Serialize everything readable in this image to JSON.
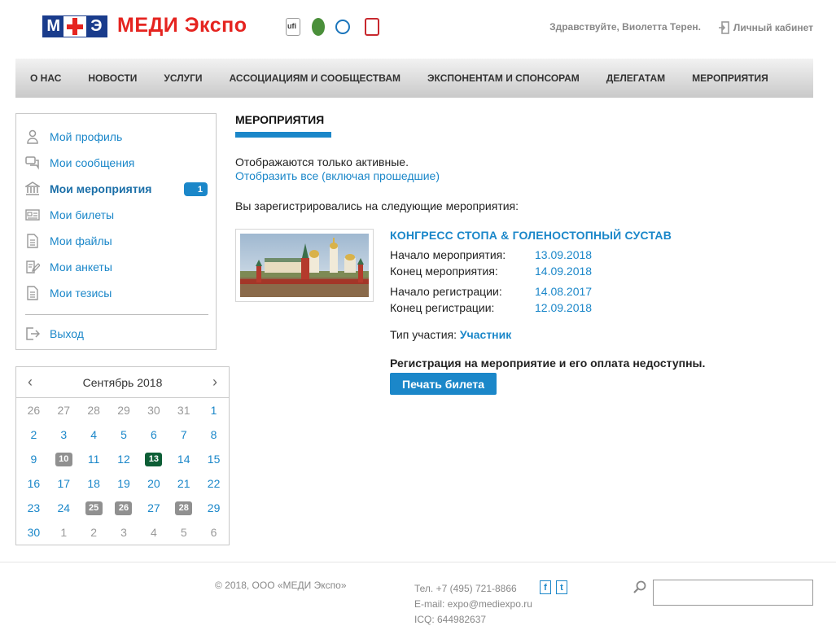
{
  "header": {
    "logo_m": "М",
    "logo_e": "Э",
    "brand": "МЕДИ Экспо",
    "greeting": "Здравствуйте, Виолетта Терен.",
    "cabinet": "Личный кабинет"
  },
  "nav": [
    "О НАС",
    "НОВОСТИ",
    "УСЛУГИ",
    "АССОЦИАЦИЯМ И СООБЩЕСТВАМ",
    "ЭКСПОНЕНТАМ И СПОНСОРАМ",
    "ДЕЛЕГАТАМ",
    "МЕРОПРИЯТИЯ"
  ],
  "sidebar": {
    "items": [
      {
        "label": "Мой профиль",
        "icon": "user-icon"
      },
      {
        "label": "Мои сообщения",
        "icon": "messages-icon"
      },
      {
        "label": "Мои мероприятия",
        "icon": "museum-icon",
        "badge": "1",
        "active": true
      },
      {
        "label": "Мои билеты",
        "icon": "ticket-icon"
      },
      {
        "label": "Мои файлы",
        "icon": "file-icon"
      },
      {
        "label": "Мои анкеты",
        "icon": "edit-form-icon"
      },
      {
        "label": "Мои тезисы",
        "icon": "document-icon"
      }
    ],
    "logout": "Выход"
  },
  "calendar": {
    "month": "Сентябрь 2018",
    "prev": "‹",
    "next": "›",
    "days": [
      {
        "d": "26",
        "m": true
      },
      {
        "d": "27",
        "m": true
      },
      {
        "d": "28",
        "m": true
      },
      {
        "d": "29",
        "m": true
      },
      {
        "d": "30",
        "m": true
      },
      {
        "d": "31",
        "m": true
      },
      {
        "d": "1"
      },
      {
        "d": "2"
      },
      {
        "d": "3"
      },
      {
        "d": "4"
      },
      {
        "d": "5"
      },
      {
        "d": "6"
      },
      {
        "d": "7"
      },
      {
        "d": "8"
      },
      {
        "d": "9"
      },
      {
        "d": "10",
        "hl": "grey"
      },
      {
        "d": "11"
      },
      {
        "d": "12"
      },
      {
        "d": "13",
        "hl": "green"
      },
      {
        "d": "14"
      },
      {
        "d": "15"
      },
      {
        "d": "16"
      },
      {
        "d": "17"
      },
      {
        "d": "18"
      },
      {
        "d": "19"
      },
      {
        "d": "20"
      },
      {
        "d": "21"
      },
      {
        "d": "22"
      },
      {
        "d": "23"
      },
      {
        "d": "24"
      },
      {
        "d": "25",
        "hl": "grey"
      },
      {
        "d": "26",
        "hl": "grey"
      },
      {
        "d": "27"
      },
      {
        "d": "28",
        "hl": "grey"
      },
      {
        "d": "29"
      },
      {
        "d": "30"
      },
      {
        "d": "1",
        "m": true
      },
      {
        "d": "2",
        "m": true
      },
      {
        "d": "3",
        "m": true
      },
      {
        "d": "4",
        "m": true
      },
      {
        "d": "5",
        "m": true
      },
      {
        "d": "6",
        "m": true
      }
    ]
  },
  "main": {
    "title": "МЕРОПРИЯТИЯ",
    "note": "Отображаются только активные.",
    "show_all": "Отобразить все (включая прошедшие)",
    "registered": "Вы зарегистрировались на следующие мероприятия:",
    "event": {
      "title": "КОНГРЕСС СТОПА & ГОЛЕНОСТОПНЫЙ СУСТАВ",
      "start_label": "Начало мероприятия:",
      "start": "13.09.2018",
      "end_label": "Конец мероприятия:",
      "end": "14.09.2018",
      "reg_start_label": "Начало регистрации:",
      "reg_start": "14.08.2017",
      "reg_end_label": "Конец регистрации:",
      "reg_end": "12.09.2018",
      "ptype_label": "Тип участия:",
      "ptype": "Участник",
      "warning": "Регистрация на мероприятие и его оплата недоступны.",
      "print": "Печать билета"
    }
  },
  "footer": {
    "copyright": "© 2018, ООО «МЕДИ Экспо»",
    "phone": "Тел. +7 (495) 721-8866",
    "email": "E-mail: expo@mediexpo.ru",
    "icq": "ICQ: 644982637",
    "facebook": "f",
    "twitter": "t"
  },
  "colors": {
    "accent": "#1b87c9",
    "brand_red": "#e52420",
    "brand_blue": "#1a3c8c",
    "today": "#0d5e36",
    "event_day": "#909090"
  }
}
